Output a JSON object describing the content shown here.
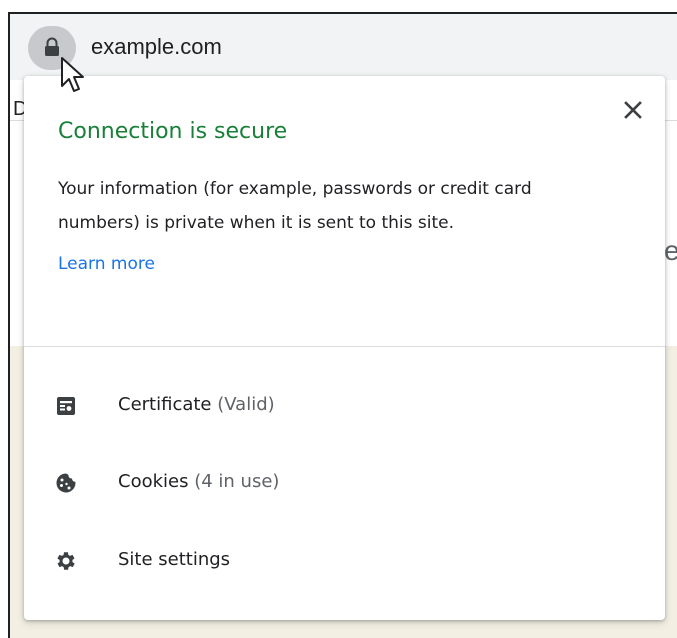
{
  "address_bar": {
    "url": "example.com"
  },
  "background_page": {
    "left_edge_text": "D",
    "right_edge_text": "e"
  },
  "popup": {
    "title": "Connection is secure",
    "description": "Your information (for example, passwords or credit card numbers) is private when it is sent to this site.",
    "learn_more": "Learn more",
    "close_icon": "close-icon",
    "items": [
      {
        "icon": "certificate-icon",
        "label": "Certificate",
        "detail": "(Valid)"
      },
      {
        "icon": "cookie-icon",
        "label": "Cookies",
        "detail": "(4 in use)"
      },
      {
        "icon": "gear-icon",
        "label": "Site settings",
        "detail": ""
      }
    ]
  },
  "colors": {
    "secure_green": "#188038",
    "link_blue": "#1a73e8",
    "text_primary": "#202124",
    "text_secondary": "#5f6368"
  }
}
